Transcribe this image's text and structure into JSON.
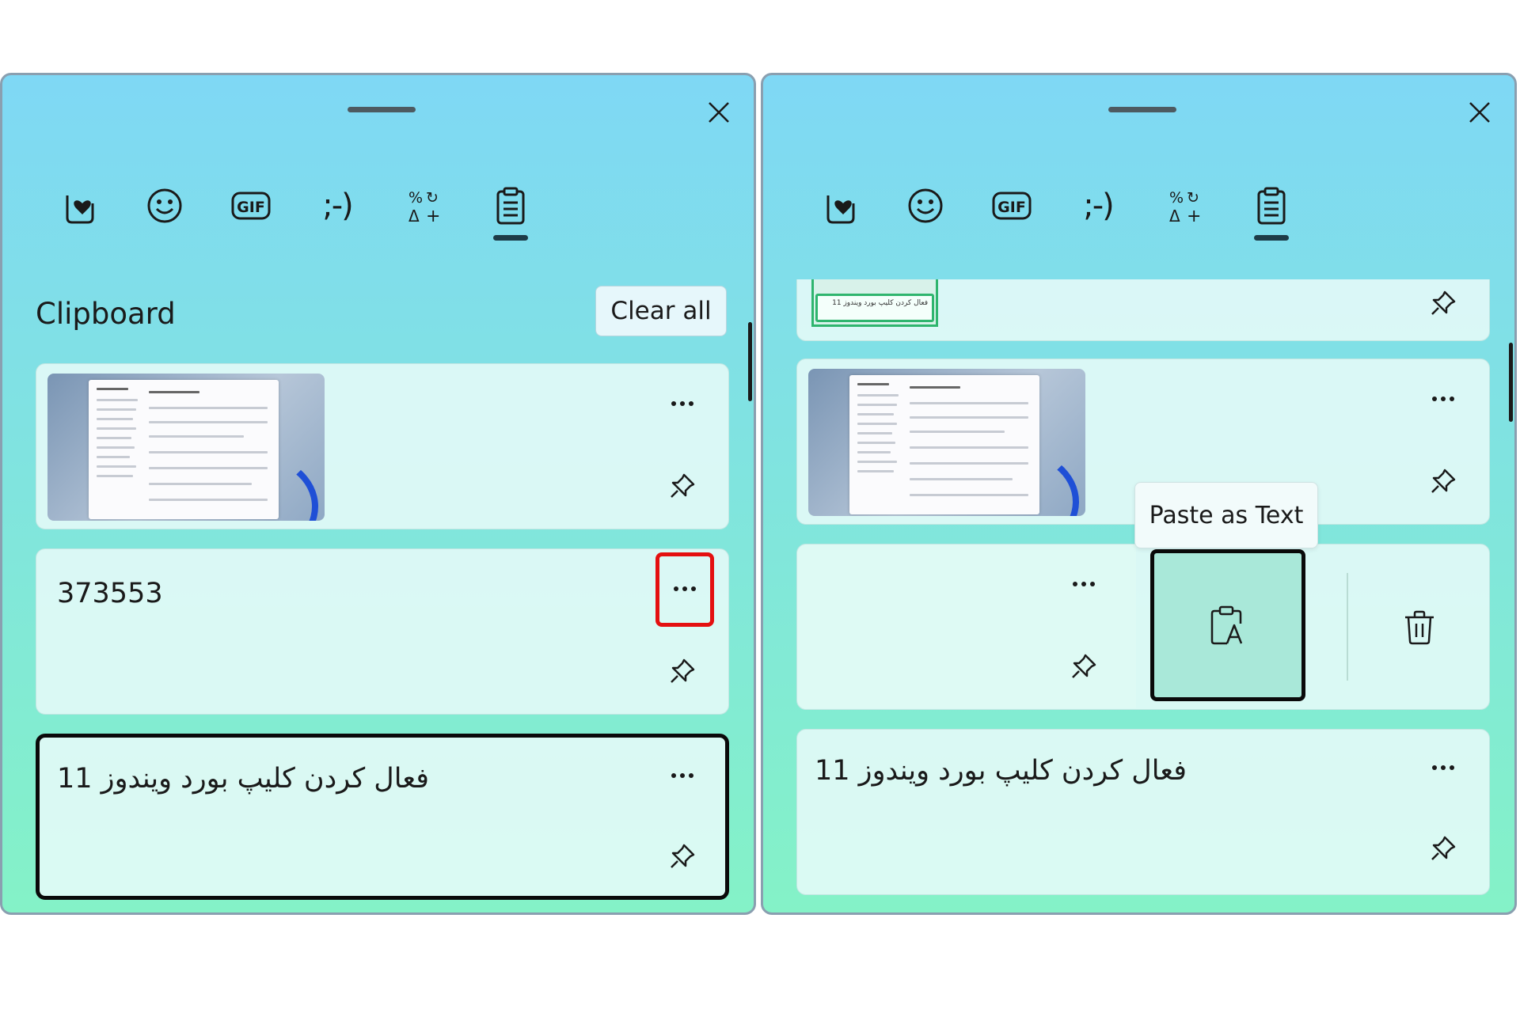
{
  "tabs": [
    {
      "name": "favorites",
      "icon": "heart-card-icon"
    },
    {
      "name": "emoji",
      "icon": "smiley-icon"
    },
    {
      "name": "gif",
      "icon": "gif-icon",
      "label": "GIF"
    },
    {
      "name": "kaomoji",
      "icon": "kaomoji-icon",
      "label": ";-)"
    },
    {
      "name": "symbols",
      "icon": "symbols-icon"
    },
    {
      "name": "clipboard",
      "icon": "clipboard-icon",
      "active": true
    }
  ],
  "left_panel": {
    "title": "Clipboard",
    "clear_all_label": "Clear all",
    "items": [
      {
        "type": "image",
        "description_icon": "screenshot-thumbnail"
      },
      {
        "type": "text",
        "text": "373553",
        "more_highlighted": true
      },
      {
        "type": "text",
        "text": "فعال کردن کلیپ بورد ویندوز 11",
        "focused": true
      }
    ]
  },
  "right_panel": {
    "partial_item_text": "فعال کردن کلیپ بورد ویندوز 11",
    "tooltip": "Paste as Text",
    "items": [
      {
        "type": "image",
        "description_icon": "screenshot-thumbnail"
      },
      {
        "type": "text-expanded",
        "actions": [
          "paste-as-text",
          "delete"
        ]
      },
      {
        "type": "text",
        "text": "فعال کردن کلیپ بورد ویندوز 11"
      }
    ]
  },
  "colors": {
    "highlight": "#e41010",
    "focus_border": "#0a0a0a",
    "panel_top": "#7fd8f5",
    "panel_bottom": "#84f2c7"
  }
}
